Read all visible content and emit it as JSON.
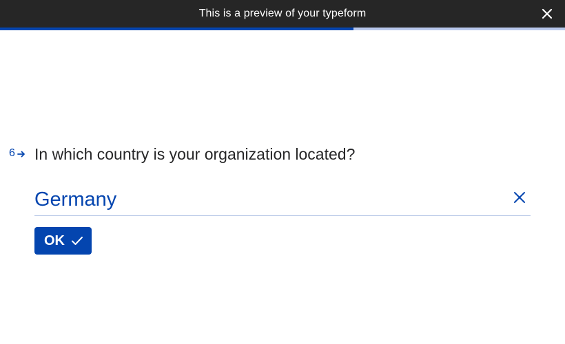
{
  "preview_bar": {
    "text": "This is a preview of your typeform",
    "close_icon": "close-icon"
  },
  "progress": {
    "fraction": 0.625
  },
  "question": {
    "number": "6",
    "number_icon": "arrow-right-icon",
    "title": "In which country is your organization located?"
  },
  "answer": {
    "value": "Germany",
    "clear_icon": "close-icon"
  },
  "ok_button": {
    "label": "OK",
    "icon": "check-icon"
  },
  "colors": {
    "accent": "#0445af",
    "bar_background": "#262626",
    "progress_track": "#b9c8ec",
    "underline": "#b6c6e6",
    "text": "#262627"
  }
}
